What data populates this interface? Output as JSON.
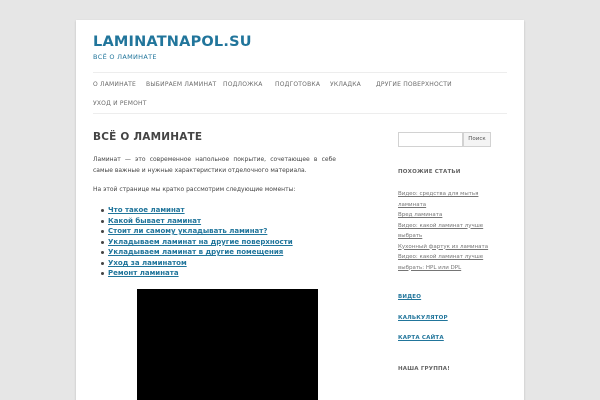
{
  "site": {
    "title": "LAMINATNAPOL.SU",
    "description": "ВСЁ О ЛАМИНАТЕ"
  },
  "nav": {
    "items": [
      {
        "label": "О ЛАМИНАТЕ"
      },
      {
        "label": "ВЫБИРАЕМ ЛАМИНАТ"
      },
      {
        "label": "ПОДЛОЖКА"
      },
      {
        "label": "ПОДГОТОВКА"
      },
      {
        "label": "УКЛАДКА"
      },
      {
        "label": "ДРУГИЕ ПОВЕРХНОСТИ"
      },
      {
        "label": "УХОД И РЕМОНТ"
      }
    ]
  },
  "main": {
    "title": "ВСЁ О ЛАМИНАТЕ",
    "intro": "Ламинат — это современное напольное покрытие, сочетающее в себе самые важные и нужные характеристики отделочного материала.",
    "lead": "На этой странице мы кратко рассмотрим следующие моменты:",
    "toc": [
      "Что такое ламинат",
      "Какой бывает ламинат",
      "Стоит ли самому укладывать ламинат?",
      "Укладываем ламинат на другие поверхности",
      "Укладываем ламинат в другие помещения",
      "Уход за ламинатом",
      "Ремонт ламината"
    ]
  },
  "sidebar": {
    "search": {
      "placeholder": "",
      "button_label": "Поиск"
    },
    "related_title": "ПОХОЖИЕ СТАТЬИ",
    "related": [
      "Видео: средства для мытья",
      "ламината",
      "Вред ламината",
      "Видео: какой ламинат лучше",
      "выбрать",
      "Кухонный фартук из ламината",
      "Видео: какой ламинат лучше",
      "выбрать: HPL или DPL"
    ],
    "video_link": "ВИДЕО",
    "calculator_link": "КАЛЬКУЛЯТОР",
    "sitemap_link": "КАРТА САЙТА",
    "group_title": "НАША ГРУППА!"
  },
  "colors": {
    "accent": "#21759b",
    "background": "#e6e6e6",
    "page": "#ffffff",
    "text": "#444444"
  }
}
